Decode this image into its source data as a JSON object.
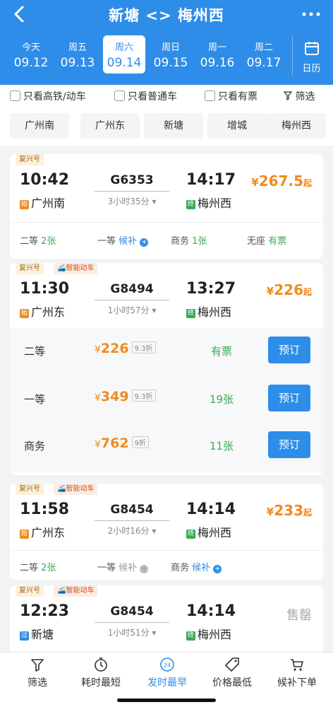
{
  "header": {
    "title": "新塘 <> 梅州西",
    "dates": [
      {
        "weekday": "今天",
        "date": "09.12"
      },
      {
        "weekday": "周五",
        "date": "09.13"
      },
      {
        "weekday": "周六",
        "date": "09.14"
      },
      {
        "weekday": "周日",
        "date": "09.15"
      },
      {
        "weekday": "周一",
        "date": "09.16"
      },
      {
        "weekday": "周二",
        "date": "09.17"
      }
    ],
    "selected_date_index": 2,
    "calendar_label": "日历"
  },
  "filters": {
    "high_speed_only": "只看高铁/动车",
    "regular_only": "只看普通车",
    "available_only": "只看有票",
    "filter": "筛选"
  },
  "stations": [
    "广州南",
    "广州东",
    "新塘",
    "增城",
    "梅州西"
  ],
  "trains": [
    {
      "tags": [
        "复兴号"
      ],
      "dep_time": "10:42",
      "train_no": "G6353",
      "arr_time": "14:17",
      "duration": "3小时35分",
      "from_badge": "始",
      "from": "广州南",
      "to_badge": "终",
      "to": "梅州西",
      "price_symbol": "¥",
      "price": "267.5",
      "price_suffix": "起",
      "seats": [
        {
          "class": "二等",
          "status": "2张"
        },
        {
          "class": "一等",
          "status": "候补"
        },
        {
          "class": "商务",
          "status": "1张"
        },
        {
          "class": "无座",
          "status": "有票"
        }
      ]
    },
    {
      "tags": [
        "复兴号",
        "智能动车"
      ],
      "dep_time": "11:30",
      "train_no": "G8494",
      "arr_time": "13:27",
      "duration": "1小时57分",
      "from_badge": "始",
      "from": "广州东",
      "to_badge": "终",
      "to": "梅州西",
      "price_symbol": "¥",
      "price": "226",
      "price_suffix": "起",
      "expanded": [
        {
          "class": "二等",
          "price": "226",
          "discount": "9.3折",
          "status": "有票",
          "action": "预订"
        },
        {
          "class": "一等",
          "price": "349",
          "discount": "9.3折",
          "status": "19张",
          "action": "预订"
        },
        {
          "class": "商务",
          "price": "762",
          "discount": "9折",
          "status": "11张",
          "action": "预订"
        }
      ]
    },
    {
      "tags": [
        "复兴号",
        "智能动车"
      ],
      "dep_time": "11:58",
      "train_no": "G8454",
      "arr_time": "14:14",
      "duration": "2小时16分",
      "from_badge": "始",
      "from": "广州东",
      "to_badge": "终",
      "to": "梅州西",
      "price_symbol": "¥",
      "price": "233",
      "price_suffix": "起",
      "seats": [
        {
          "class": "二等",
          "status": "2张"
        },
        {
          "class": "一等",
          "status": "候补"
        },
        {
          "class": "商务",
          "status": "候补"
        }
      ]
    },
    {
      "tags": [
        "复兴号",
        "智能动车"
      ],
      "dep_time": "12:23",
      "train_no": "G8454",
      "arr_time": "14:14",
      "duration": "1小时51分",
      "from_badge": "过",
      "from": "新塘",
      "to_badge": "终",
      "to": "梅州西",
      "sold_out": "售罄"
    }
  ],
  "bottom_bar": [
    {
      "label": "筛选",
      "icon": "filter-icon"
    },
    {
      "label": "耗时最短",
      "icon": "clock-icon"
    },
    {
      "label": "发时最早",
      "icon": "24h-icon"
    },
    {
      "label": "价格最低",
      "icon": "price-tag-icon"
    },
    {
      "label": "候补下单",
      "icon": "cart-icon"
    }
  ],
  "colors": {
    "primary": "#2e8de8",
    "price": "#f28a1c",
    "available": "#3aaa55"
  }
}
